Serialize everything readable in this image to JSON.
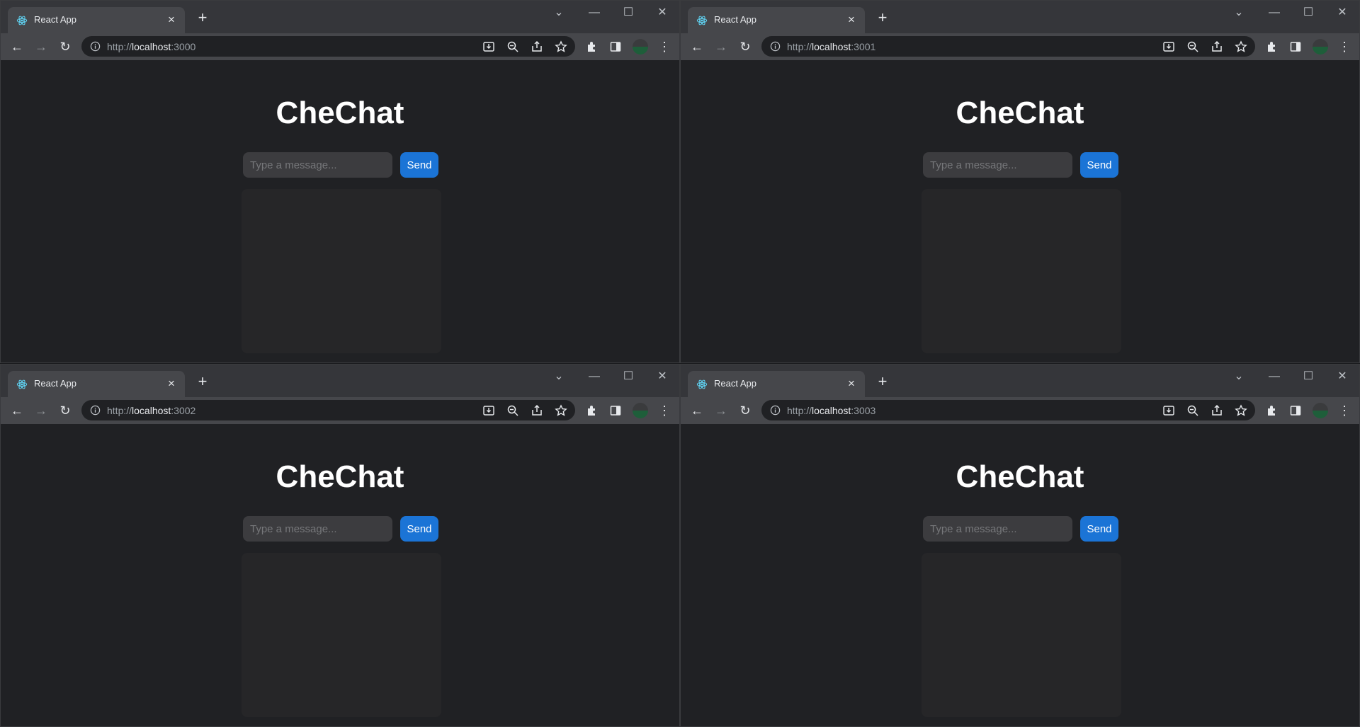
{
  "windows": [
    {
      "tab_title": "React App",
      "url_scheme": "http://",
      "url_host": "localhost",
      "url_port": ":3000",
      "app_title": "CheChat",
      "input_placeholder": "Type a message...",
      "send_label": "Send"
    },
    {
      "tab_title": "React App",
      "url_scheme": "http://",
      "url_host": "localhost",
      "url_port": ":3001",
      "app_title": "CheChat",
      "input_placeholder": "Type a message...",
      "send_label": "Send"
    },
    {
      "tab_title": "React App",
      "url_scheme": "http://",
      "url_host": "localhost",
      "url_port": ":3002",
      "app_title": "CheChat",
      "input_placeholder": "Type a message...",
      "send_label": "Send"
    },
    {
      "tab_title": "React App",
      "url_scheme": "http://",
      "url_host": "localhost",
      "url_port": ":3003",
      "app_title": "CheChat",
      "input_placeholder": "Type a message...",
      "send_label": "Send"
    }
  ],
  "icons": {
    "tab_favicon": "react-logo-icon",
    "tab_close": "close-icon",
    "new_tab": "plus-icon",
    "tab_search": "chevron-down-icon",
    "minimize": "minimize-icon",
    "maximize": "maximize-icon",
    "close_window": "close-icon",
    "back": "arrow-left-icon",
    "forward": "arrow-right-icon",
    "reload": "reload-icon",
    "site_info": "info-icon",
    "install": "install-icon",
    "zoom": "zoom-icon",
    "share": "share-icon",
    "bookmark": "star-icon",
    "extensions": "puzzle-icon",
    "side_panel": "side-panel-icon",
    "profile": "avatar",
    "menu": "kebab-menu-icon"
  },
  "colors": {
    "page_background": "#202124",
    "send_button": "#1b74d6",
    "input_background": "#3c3c3f",
    "message_panel": "#262628",
    "title_text": "#ffffff"
  }
}
